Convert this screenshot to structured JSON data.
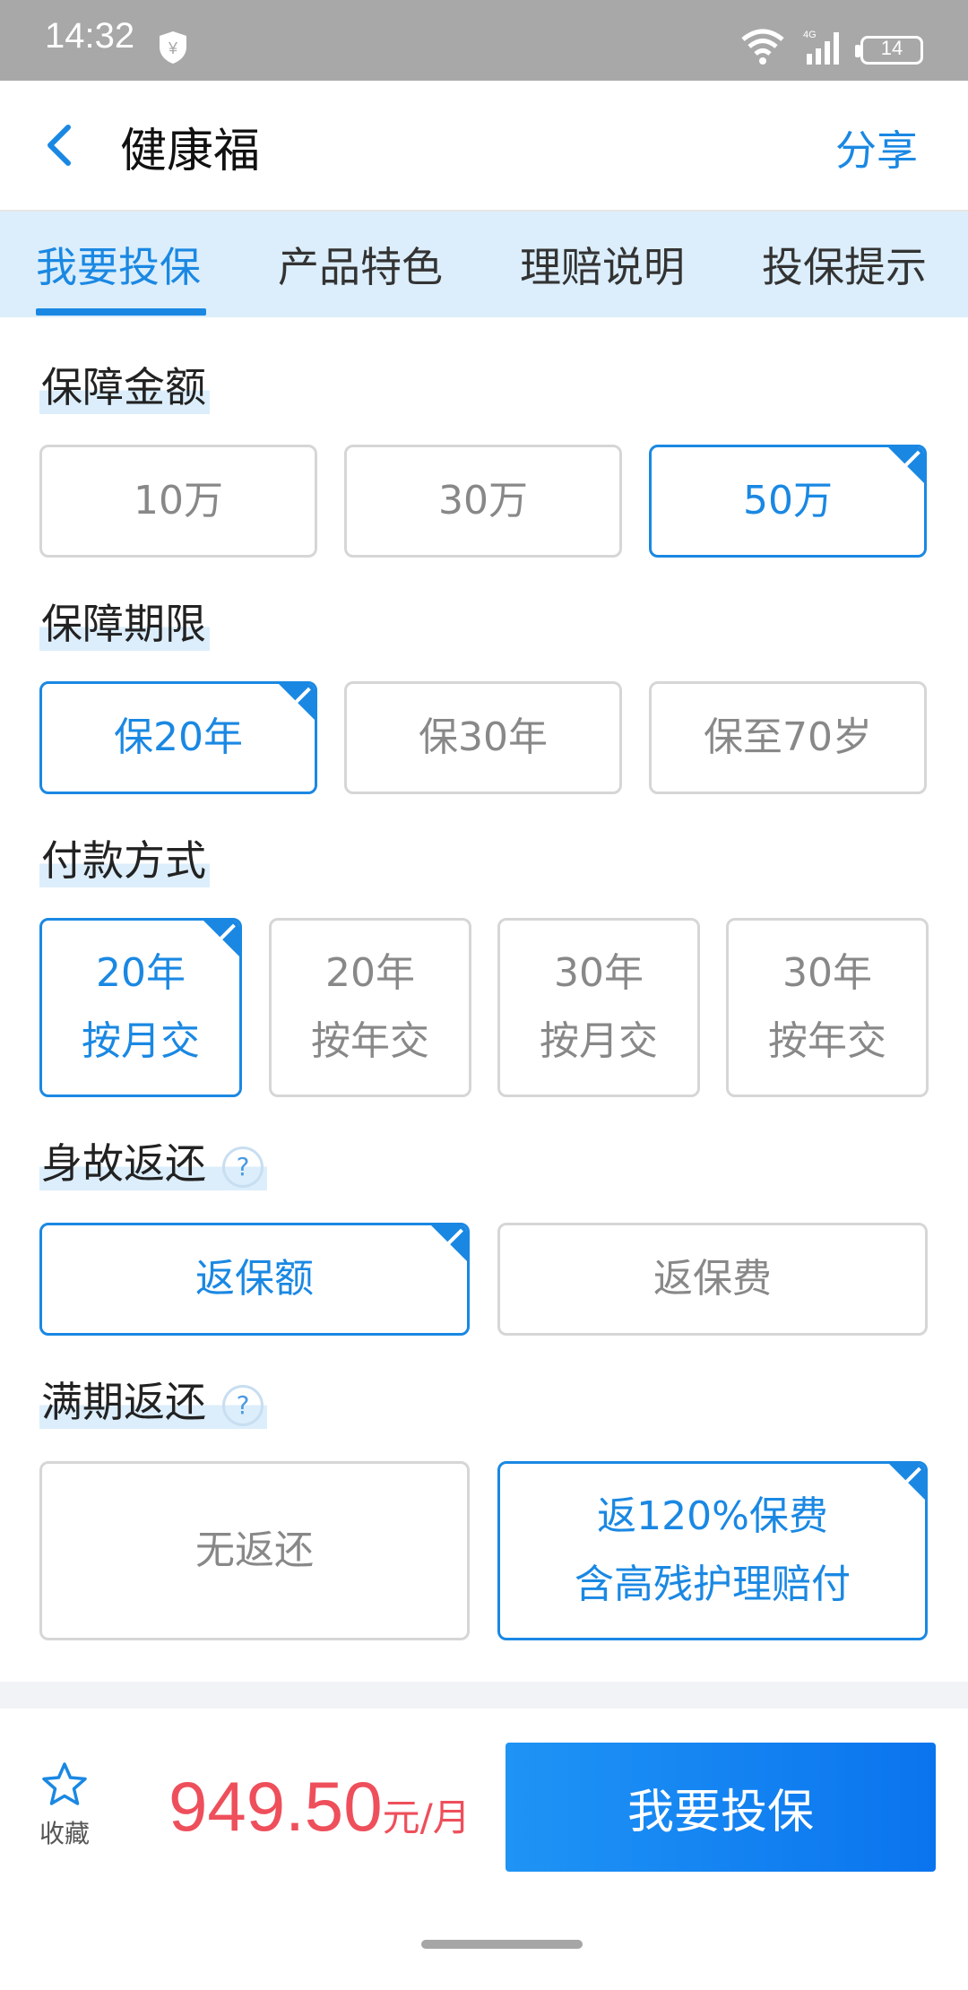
{
  "status_bar": {
    "time": "14:32",
    "battery": "14"
  },
  "header": {
    "title": "健康福",
    "share": "分享"
  },
  "tabs": [
    {
      "label": "我要投保",
      "active": true
    },
    {
      "label": "产品特色"
    },
    {
      "label": "理赔说明"
    },
    {
      "label": "投保提示"
    }
  ],
  "sections": {
    "amount": {
      "title": "保障金额",
      "options": [
        "10万",
        "30万",
        "50万"
      ],
      "selected": "50万"
    },
    "term": {
      "title": "保障期限",
      "options": [
        "保20年",
        "保30年",
        "保至70岁"
      ],
      "selected": "保20年"
    },
    "payment": {
      "title": "付款方式",
      "options": [
        {
          "line1": "20年",
          "line2": "按月交"
        },
        {
          "line1": "20年",
          "line2": "按年交"
        },
        {
          "line1": "30年",
          "line2": "按月交"
        },
        {
          "line1": "30年",
          "line2": "按年交"
        }
      ],
      "selected_index": 0
    },
    "death_return": {
      "title": "身故返还",
      "help": "?",
      "options": [
        "返保额",
        "返保费"
      ],
      "selected": "返保额"
    },
    "maturity_return": {
      "title": "满期返还",
      "help": "?",
      "options": [
        {
          "line1": "无返还",
          "line2": ""
        },
        {
          "line1": "返120%保费",
          "line2": "含高残护理赔付"
        }
      ],
      "selected_index": 1
    }
  },
  "bottom_bar": {
    "favorite_label": "收藏",
    "price": "949.50",
    "price_unit": "元/月",
    "cta": "我要投保"
  },
  "colors": {
    "accent": "#1a88e3",
    "tab_bg": "#dceefb",
    "price": "#ee4f5b",
    "border": "#d6d6d6",
    "status_bar": "#a8a8a8"
  }
}
